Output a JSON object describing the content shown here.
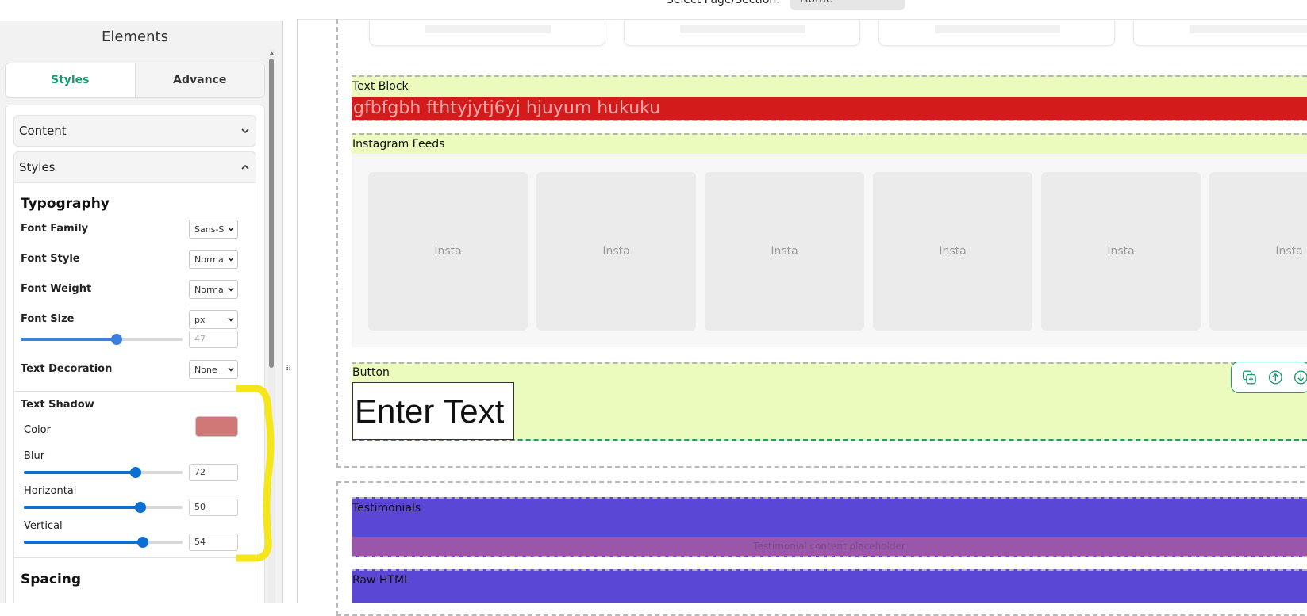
{
  "panel": {
    "title": "Elements",
    "tabs": [
      {
        "label": "Styles",
        "active": true
      },
      {
        "label": "Advance",
        "active": false
      }
    ],
    "accordions": {
      "content": "Content",
      "styles": "Styles"
    },
    "typography": {
      "title": "Typography",
      "font_family": {
        "label": "Font Family",
        "value": "Sans-S"
      },
      "font_style": {
        "label": "Font Style",
        "value": "Norma"
      },
      "font_weight": {
        "label": "Font Weight",
        "value": "Norma"
      },
      "font_size": {
        "label": "Font Size",
        "unit": "px",
        "value": "47",
        "slider_fraction": 0.6
      },
      "text_decoration": {
        "label": "Text Decoration",
        "value": "None"
      }
    },
    "text_shadow": {
      "title": "Text Shadow",
      "color_label": "Color",
      "color_value": "#d07878",
      "blur": {
        "label": "Blur",
        "value": "72",
        "slider_fraction": 0.72
      },
      "horizontal": {
        "label": "Horizontal",
        "value": "50",
        "slider_fraction": 0.75
      },
      "vertical": {
        "label": "Vertical",
        "value": "54",
        "slider_fraction": 0.77
      }
    },
    "spacing_title": "Spacing"
  },
  "toolbar": {
    "page_select_label": "Select Page/Section:",
    "page_select_value": "Home"
  },
  "canvas": {
    "text_block": {
      "label": "Text Block",
      "text": "gfbfgbh fthtyjytj6yj hjuyum hukuku"
    },
    "instagram": {
      "label": "Instagram Feeds",
      "tiles": [
        "Insta",
        "Insta",
        "Insta",
        "Insta",
        "Insta",
        "Insta"
      ]
    },
    "button_block": {
      "label": "Button",
      "button_text": "Enter Text"
    },
    "testimonials": {
      "label": "Testimonials",
      "inner_text": "Testimonial content placeholder"
    },
    "raw_html": {
      "label": "Raw HTML"
    }
  },
  "colors": {
    "accent": "#1a9a6e",
    "slider_blue": "#3d7fe0",
    "text_block_red": "#d31b1b",
    "block_lime": "#ebfbbd",
    "testimonials_purple": "#5a47d6",
    "annotation_yellow": "#f5e61c"
  }
}
